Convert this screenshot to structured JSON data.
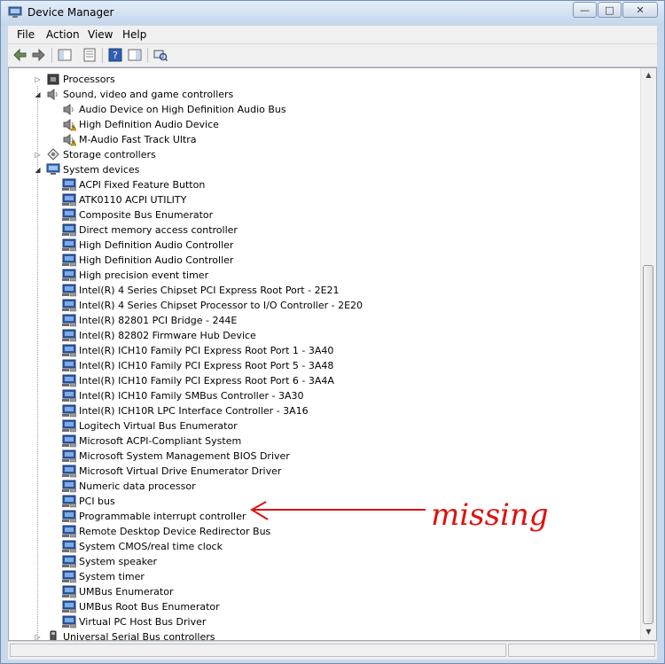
{
  "window": {
    "title": "Device Manager"
  },
  "menu": {
    "items": [
      "File",
      "Action",
      "View",
      "Help"
    ]
  },
  "tree": [
    {
      "kind": "cat",
      "label": "Processors",
      "expanded": false,
      "icon": "processor-icon"
    },
    {
      "kind": "cat",
      "label": "Sound, video and game controllers",
      "expanded": true,
      "icon": "speaker-icon"
    },
    {
      "kind": "child",
      "label": "Audio Device on High Definition Audio Bus",
      "icon": "speaker-icon"
    },
    {
      "kind": "child",
      "label": "High Definition Audio Device",
      "icon": "speaker-warning-icon"
    },
    {
      "kind": "child",
      "label": "M-Audio Fast Track Ultra",
      "icon": "speaker-warning-icon"
    },
    {
      "kind": "cat",
      "label": "Storage controllers",
      "expanded": false,
      "icon": "storage-icon"
    },
    {
      "kind": "cat",
      "label": "System devices",
      "expanded": true,
      "icon": "computer-icon"
    },
    {
      "kind": "child",
      "label": "ACPI Fixed Feature Button",
      "icon": "system-device-icon"
    },
    {
      "kind": "child",
      "label": "ATK0110 ACPI UTILITY",
      "icon": "system-device-icon"
    },
    {
      "kind": "child",
      "label": "Composite Bus Enumerator",
      "icon": "system-device-icon"
    },
    {
      "kind": "child",
      "label": "Direct memory access controller",
      "icon": "system-device-icon"
    },
    {
      "kind": "child",
      "label": "High Definition Audio Controller",
      "icon": "system-device-icon"
    },
    {
      "kind": "child",
      "label": "High Definition Audio Controller",
      "icon": "system-device-icon"
    },
    {
      "kind": "child",
      "label": "High precision event timer",
      "icon": "system-device-icon"
    },
    {
      "kind": "child",
      "label": "Intel(R) 4 Series Chipset PCI Express Root Port - 2E21",
      "icon": "system-device-icon"
    },
    {
      "kind": "child",
      "label": "Intel(R) 4 Series Chipset Processor to I/O Controller - 2E20",
      "icon": "system-device-icon"
    },
    {
      "kind": "child",
      "label": "Intel(R) 82801 PCI Bridge - 244E",
      "icon": "system-device-icon"
    },
    {
      "kind": "child",
      "label": "Intel(R) 82802 Firmware Hub Device",
      "icon": "system-device-icon"
    },
    {
      "kind": "child",
      "label": "Intel(R) ICH10 Family PCI Express Root Port 1 - 3A40",
      "icon": "system-device-icon"
    },
    {
      "kind": "child",
      "label": "Intel(R) ICH10 Family PCI Express Root Port 5 - 3A48",
      "icon": "system-device-icon"
    },
    {
      "kind": "child",
      "label": "Intel(R) ICH10 Family PCI Express Root Port 6 - 3A4A",
      "icon": "system-device-icon"
    },
    {
      "kind": "child",
      "label": "Intel(R) ICH10 Family SMBus Controller - 3A30",
      "icon": "system-device-icon"
    },
    {
      "kind": "child",
      "label": "Intel(R) ICH10R LPC Interface Controller - 3A16",
      "icon": "system-device-icon"
    },
    {
      "kind": "child",
      "label": "Logitech Virtual Bus Enumerator",
      "icon": "system-device-icon"
    },
    {
      "kind": "child",
      "label": "Microsoft ACPI-Compliant System",
      "icon": "system-device-icon"
    },
    {
      "kind": "child",
      "label": "Microsoft System Management BIOS Driver",
      "icon": "system-device-icon"
    },
    {
      "kind": "child",
      "label": "Microsoft Virtual Drive Enumerator Driver",
      "icon": "system-device-icon"
    },
    {
      "kind": "child",
      "label": "Numeric data processor",
      "icon": "system-device-icon"
    },
    {
      "kind": "child",
      "label": "PCI bus",
      "icon": "system-device-icon"
    },
    {
      "kind": "child",
      "label": "Programmable interrupt controller",
      "icon": "system-device-icon"
    },
    {
      "kind": "child",
      "label": "Remote Desktop Device Redirector Bus",
      "icon": "system-device-icon"
    },
    {
      "kind": "child",
      "label": "System CMOS/real time clock",
      "icon": "system-device-icon"
    },
    {
      "kind": "child",
      "label": "System speaker",
      "icon": "system-device-icon"
    },
    {
      "kind": "child",
      "label": "System timer",
      "icon": "system-device-icon"
    },
    {
      "kind": "child",
      "label": "UMBus Enumerator",
      "icon": "system-device-icon"
    },
    {
      "kind": "child",
      "label": "UMBus Root Bus Enumerator",
      "icon": "system-device-icon"
    },
    {
      "kind": "child",
      "label": "Virtual PC Host Bus Driver",
      "icon": "system-device-icon"
    },
    {
      "kind": "cat",
      "label": "Universal Serial Bus controllers",
      "expanded": false,
      "icon": "usb-icon"
    }
  ],
  "annotation": {
    "text": "missing",
    "color": "#e01010"
  }
}
